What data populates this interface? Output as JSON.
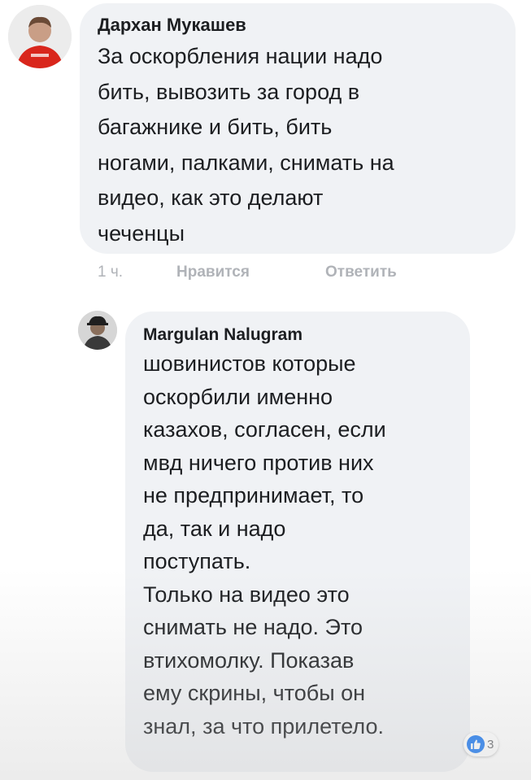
{
  "comments": [
    {
      "author": "Дархан Мукашев",
      "text": "За оскорбления нации надо\nбить, вывозить за город в\nбагажнике и бить, бить\nногами, палками, снимать на\nвидео, как это делают\nчеченцы",
      "actions": {
        "time": "1 ч.",
        "like": "Нравится",
        "reply": "Ответить"
      }
    },
    {
      "author": "Margulan Nalugram",
      "text": "шовинистов которые\nоскорбили именно\nказахов, согласен, если\nмвд ничего против них\nне предпринимает, то\nда, так и надо\nпоступать.\nТолько на видео это\nснимать не надо. Это\nвтихомолку. Показав\nему скрины, чтобы он\nзнал, за что прилетело.",
      "reactions": {
        "icon": "like-icon",
        "count": "3"
      }
    }
  ],
  "colors": {
    "bubble": "#f0f2f5",
    "text": "#1c1e21",
    "meta": "#b0b3b8",
    "like": "#1877f2",
    "avatar1_shirt": "#d9261c"
  }
}
